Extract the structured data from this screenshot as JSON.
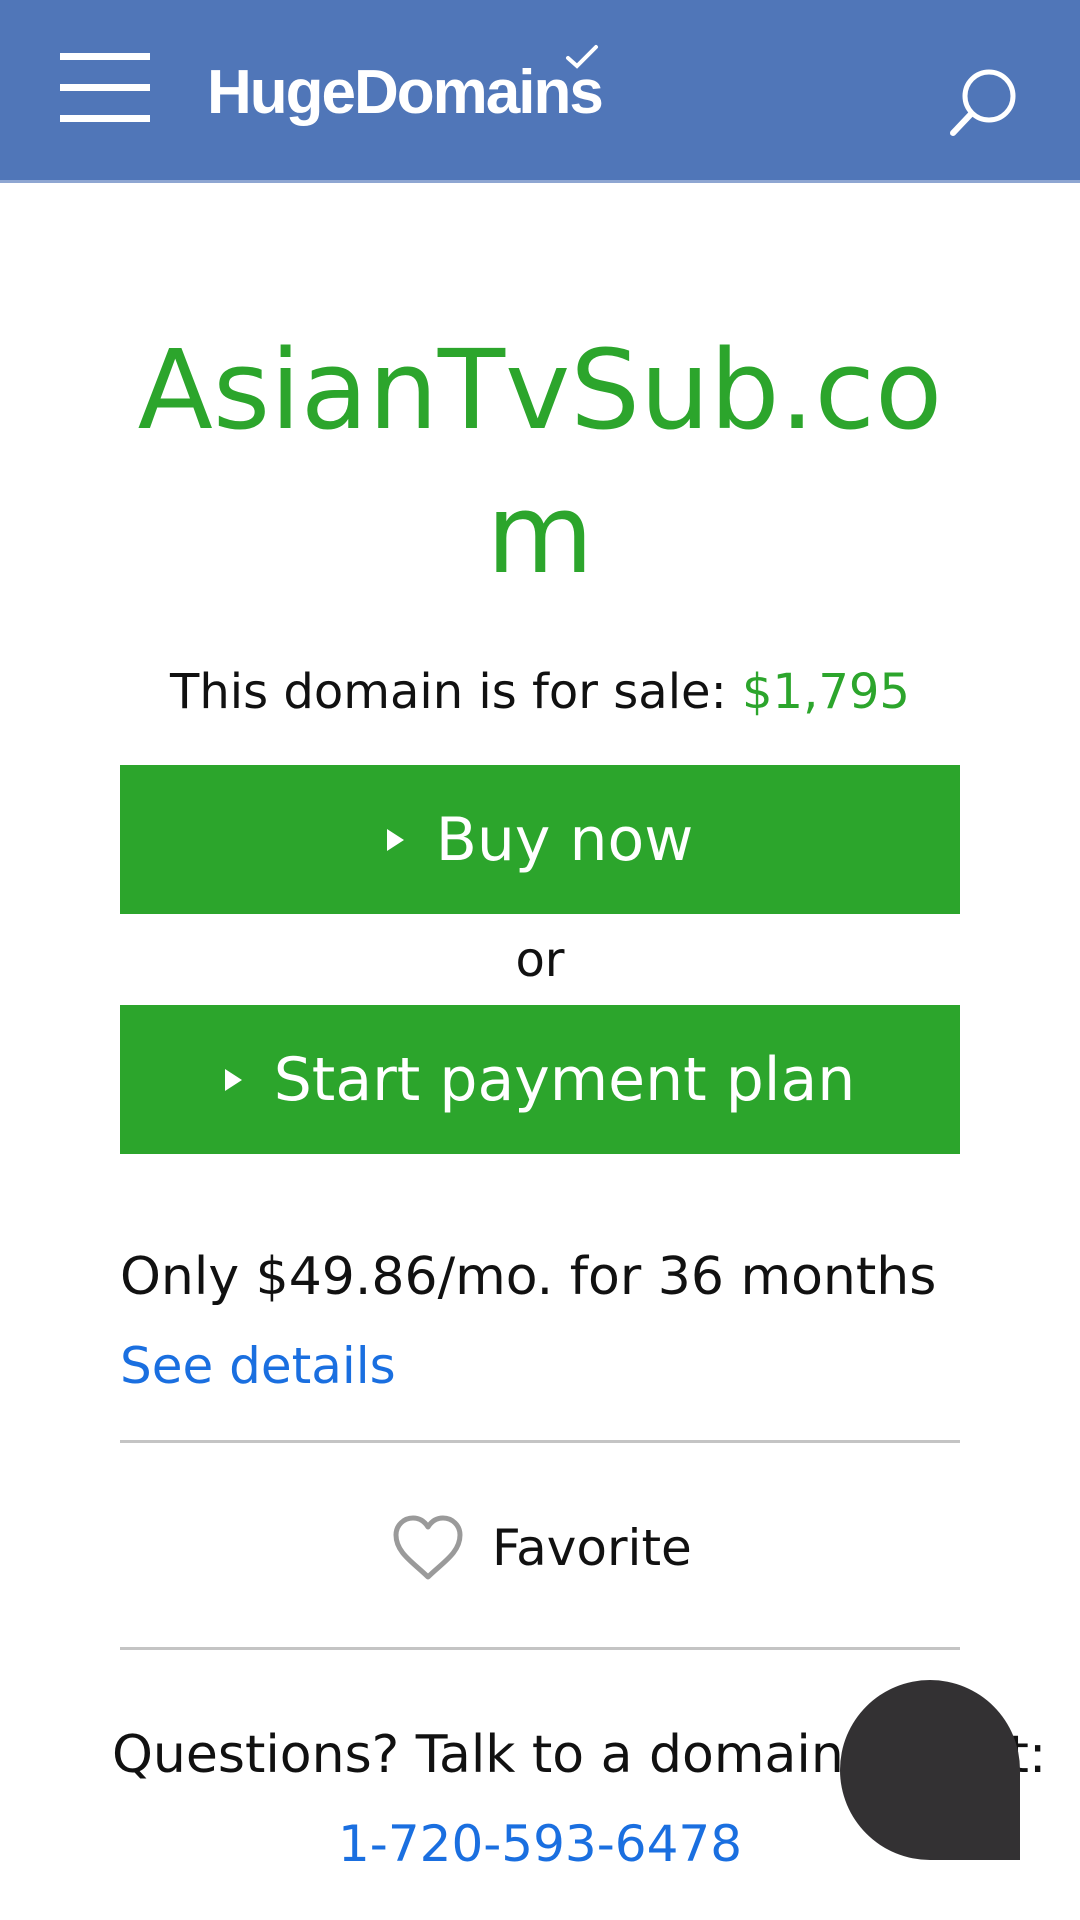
{
  "header": {
    "logo_text": "HugeDomains",
    "menu_icon": "hamburger-menu-icon",
    "search_icon": "search-icon",
    "background_color": "#5076b8"
  },
  "domain": {
    "name": "AsianTvSub.com",
    "sale_text": "This domain is for sale:",
    "price": "$1,795"
  },
  "actions": {
    "buy_now_label": "Buy now",
    "or_label": "or",
    "payment_plan_label": "Start payment plan",
    "button_color": "#2ca52c"
  },
  "payment_plan": {
    "monthly_text": "Only $49.86/mo. for 36 months",
    "details_link": "See details"
  },
  "favorite": {
    "label": "Favorite",
    "icon": "heart-icon"
  },
  "contact": {
    "questions_text": "Questions? Talk to a domain expert:",
    "phone": "1-720-593-6478"
  },
  "chat": {
    "icon": "chat-bubble-icon",
    "color": "#333133"
  }
}
